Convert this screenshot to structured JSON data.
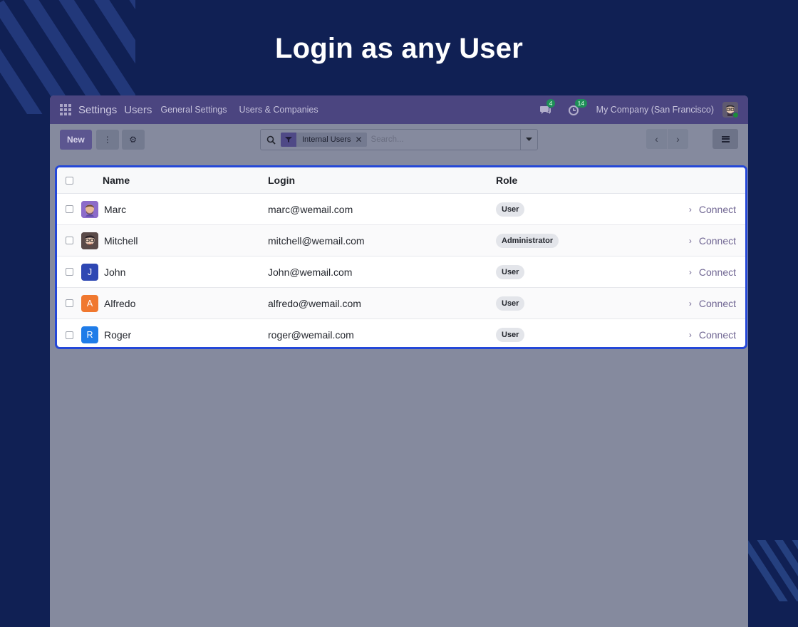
{
  "hero": {
    "title": "Login as any User"
  },
  "navbar": {
    "brand": "Settings",
    "menu": [
      "Users",
      "General Settings",
      "Users & Companies"
    ],
    "messages_count": "4",
    "activities_count": "14",
    "company": "My Company (San Francisco)"
  },
  "control": {
    "new_label": "New",
    "facet_label": "Internal Users",
    "search_placeholder": "Search..."
  },
  "table": {
    "columns": {
      "name": "Name",
      "login": "Login",
      "role": "Role"
    },
    "action_label": "Connect",
    "rows": [
      {
        "initial": "",
        "name": "Marc",
        "login": "marc@wemail.com",
        "role": "User",
        "avatar": "photo-marc",
        "color": "#8c6bc9"
      },
      {
        "initial": "",
        "name": "Mitchell",
        "login": "mitchell@wemail.com",
        "role": "Administrator",
        "avatar": "photo-mitchell",
        "color": "#5a4a48"
      },
      {
        "initial": "J",
        "name": "John",
        "login": "John@wemail.com",
        "role": "User",
        "avatar": "letter",
        "color": "#2e47b3"
      },
      {
        "initial": "A",
        "name": "Alfredo",
        "login": "alfredo@wemail.com",
        "role": "User",
        "avatar": "letter",
        "color": "#f0782f"
      },
      {
        "initial": "R",
        "name": "Roger",
        "login": "roger@wemail.com",
        "role": "User",
        "avatar": "letter",
        "color": "#1f7ce8"
      }
    ]
  },
  "colors": {
    "background": "#102054",
    "navbar": "#4b4580",
    "highlight_border": "#2447d8",
    "connect_link": "#6f6592"
  }
}
